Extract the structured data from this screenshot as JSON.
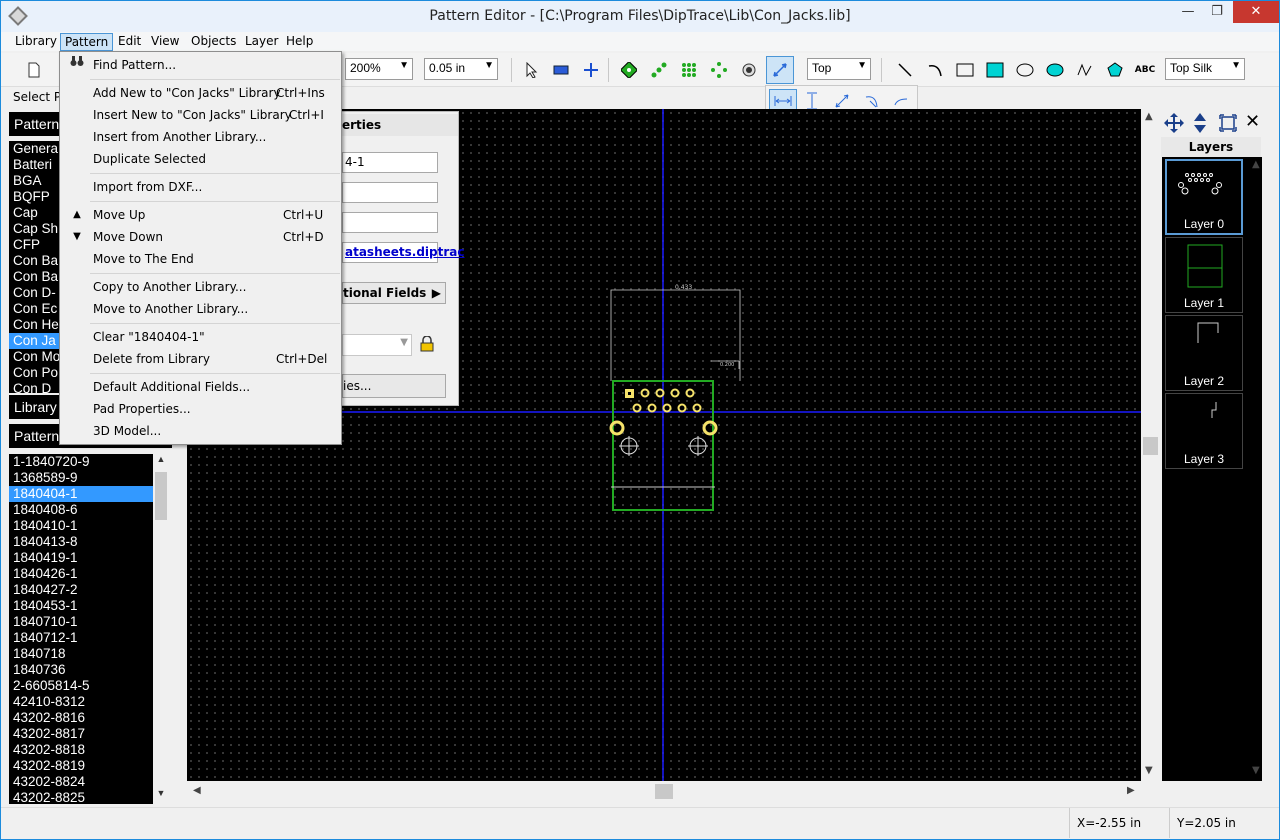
{
  "window": {
    "title": "Pattern Editor - [C:\\Program Files\\DipTrace\\Lib\\Con_Jacks.lib]",
    "minimize": "—",
    "maximize": "❐",
    "close": "✕"
  },
  "menubar": [
    "Library",
    "Pattern",
    "Edit",
    "View",
    "Objects",
    "Layer",
    "Help"
  ],
  "toolbar": {
    "zoom": "200%",
    "grid": "0.05 in",
    "side": "Top",
    "text_tool": "ABC",
    "layer": "Top Silk"
  },
  "left_panel": {
    "select_label": "Select P",
    "patterns_head": "Pattern",
    "categories": [
      "Genera",
      "Batteri",
      "BGA",
      "BQFP",
      "Cap",
      "Cap Sh",
      "CFP",
      "Con Ba",
      "Con Ba",
      "Con D-",
      "Con Ec",
      "Con He",
      "Con Ja",
      "Con Mo",
      "Con Po",
      "Con D"
    ],
    "selected_category_index": 12,
    "library_head": "Library",
    "pattern_head": "Pattern",
    "patterns": [
      "1-1840720-9",
      "1368589-9",
      "1840404-1",
      "1840408-6",
      "1840410-1",
      "1840413-8",
      "1840419-1",
      "1840426-1",
      "1840427-2",
      "1840453-1",
      "1840710-1",
      "1840712-1",
      "1840718",
      "1840736",
      "2-6605814-5",
      "42410-8312",
      "43202-8816",
      "43202-8817",
      "43202-8818",
      "43202-8819",
      "43202-8824",
      "43202-8825"
    ],
    "selected_pattern_index": 2
  },
  "properties": {
    "header": "erties",
    "name_value": "4-1",
    "link_value": "atasheets.diptrac",
    "additional_fields": "tional Fields",
    "pad_props": "ies..."
  },
  "pattern_menu": {
    "items": [
      {
        "label": "Find Pattern...",
        "shortcut": "",
        "icon": "binoculars-icon"
      },
      {
        "label": "Add New to \"Con Jacks\" Library",
        "shortcut": "Ctrl+Ins",
        "icon": ""
      },
      {
        "label": "Insert New to \"Con Jacks\" Library",
        "shortcut": "Ctrl+I",
        "icon": ""
      },
      {
        "label": "Insert from Another Library...",
        "shortcut": "",
        "icon": ""
      },
      {
        "label": "Duplicate Selected",
        "shortcut": "",
        "icon": ""
      },
      {
        "label": "Import from DXF...",
        "shortcut": "",
        "icon": ""
      },
      {
        "label": "Move Up",
        "shortcut": "Ctrl+U",
        "icon": "arrow-up-icon"
      },
      {
        "label": "Move Down",
        "shortcut": "Ctrl+D",
        "icon": "arrow-down-icon"
      },
      {
        "label": "Move to The End",
        "shortcut": "",
        "icon": ""
      },
      {
        "label": "Copy to Another Library...",
        "shortcut": "",
        "icon": ""
      },
      {
        "label": "Move to Another Library...",
        "shortcut": "",
        "icon": ""
      },
      {
        "label": "Clear \"1840404-1\"",
        "shortcut": "",
        "icon": ""
      },
      {
        "label": "Delete from Library",
        "shortcut": "Ctrl+Del",
        "icon": ""
      },
      {
        "label": "Default Additional Fields...",
        "shortcut": "",
        "icon": ""
      },
      {
        "label": "Pad Properties...",
        "shortcut": "",
        "icon": ""
      },
      {
        "label": "3D Model...",
        "shortcut": "",
        "icon": ""
      }
    ]
  },
  "layers": {
    "title": "Layers",
    "items": [
      "Layer 0",
      "Layer 1",
      "Layer 2",
      "Layer 3"
    ]
  },
  "canvas": {
    "dim_top": "0.433",
    "dim_side": "0.200"
  },
  "status": {
    "x": "X=-2.55 in",
    "y": "Y=2.05 in"
  },
  "colors": {
    "accent": "#3399ff",
    "outline": "#22aa22",
    "pad": "#f5e26a",
    "crosshair": "#1a1aff"
  }
}
